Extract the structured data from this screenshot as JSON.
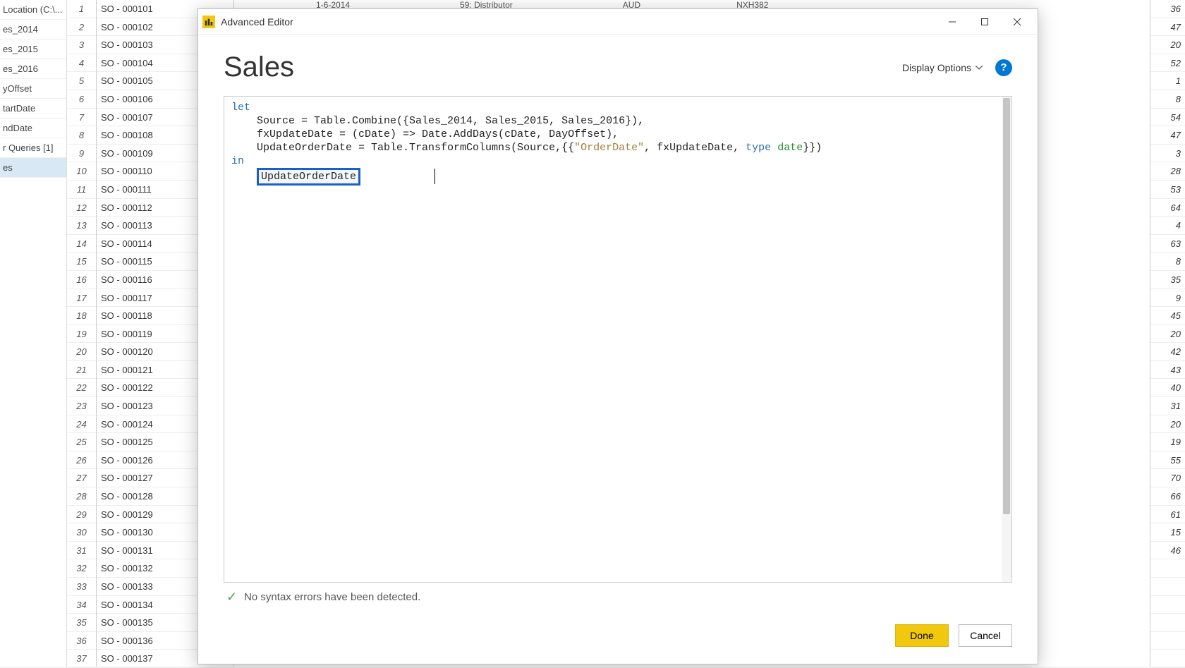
{
  "bg": {
    "left_items": [
      "Location (C:\\...",
      "es_2014",
      "es_2015",
      "es_2016",
      "yOffset",
      "tartDate",
      "ndDate",
      "r Queries [1]",
      "es"
    ],
    "left_selected_index": 8,
    "header": {
      "date": "1-6-2014",
      "mid": "59: Distributor",
      "cur": "AUD",
      "code": "NXH382"
    },
    "so_prefix": "SO - 000",
    "so_start": 101,
    "so_count": 37,
    "right_values": [
      36,
      47,
      20,
      52,
      1,
      8,
      54,
      47,
      3,
      28,
      53,
      64,
      4,
      63,
      8,
      35,
      9,
      45,
      20,
      42,
      43,
      40,
      31,
      20,
      19,
      55,
      70,
      66,
      61,
      15,
      46,
      "",
      "",
      "",
      "",
      "",
      ""
    ]
  },
  "modal": {
    "title": "Advanced Editor",
    "heading": "Sales",
    "display_options": "Display Options",
    "code": {
      "l1_let": "let",
      "l2": "    Source = Table.Combine({Sales_2014, Sales_2015, Sales_2016}),",
      "l3": "    fxUpdateDate = (cDate) => Date.AddDays(cDate, DayOffset),",
      "l4a": "    UpdateOrderDate = Table.TransformColumns(Source,{{",
      "l4_str": "\"OrderDate\"",
      "l4b": ", fxUpdateDate, ",
      "l4_type": "type",
      "l4_sp": " ",
      "l4_date": "date",
      "l4c": "}})",
      "l5_in": "in",
      "l6_sel": "UpdateOrderDate"
    },
    "status": "No syntax errors have been detected.",
    "done": "Done",
    "cancel": "Cancel"
  }
}
